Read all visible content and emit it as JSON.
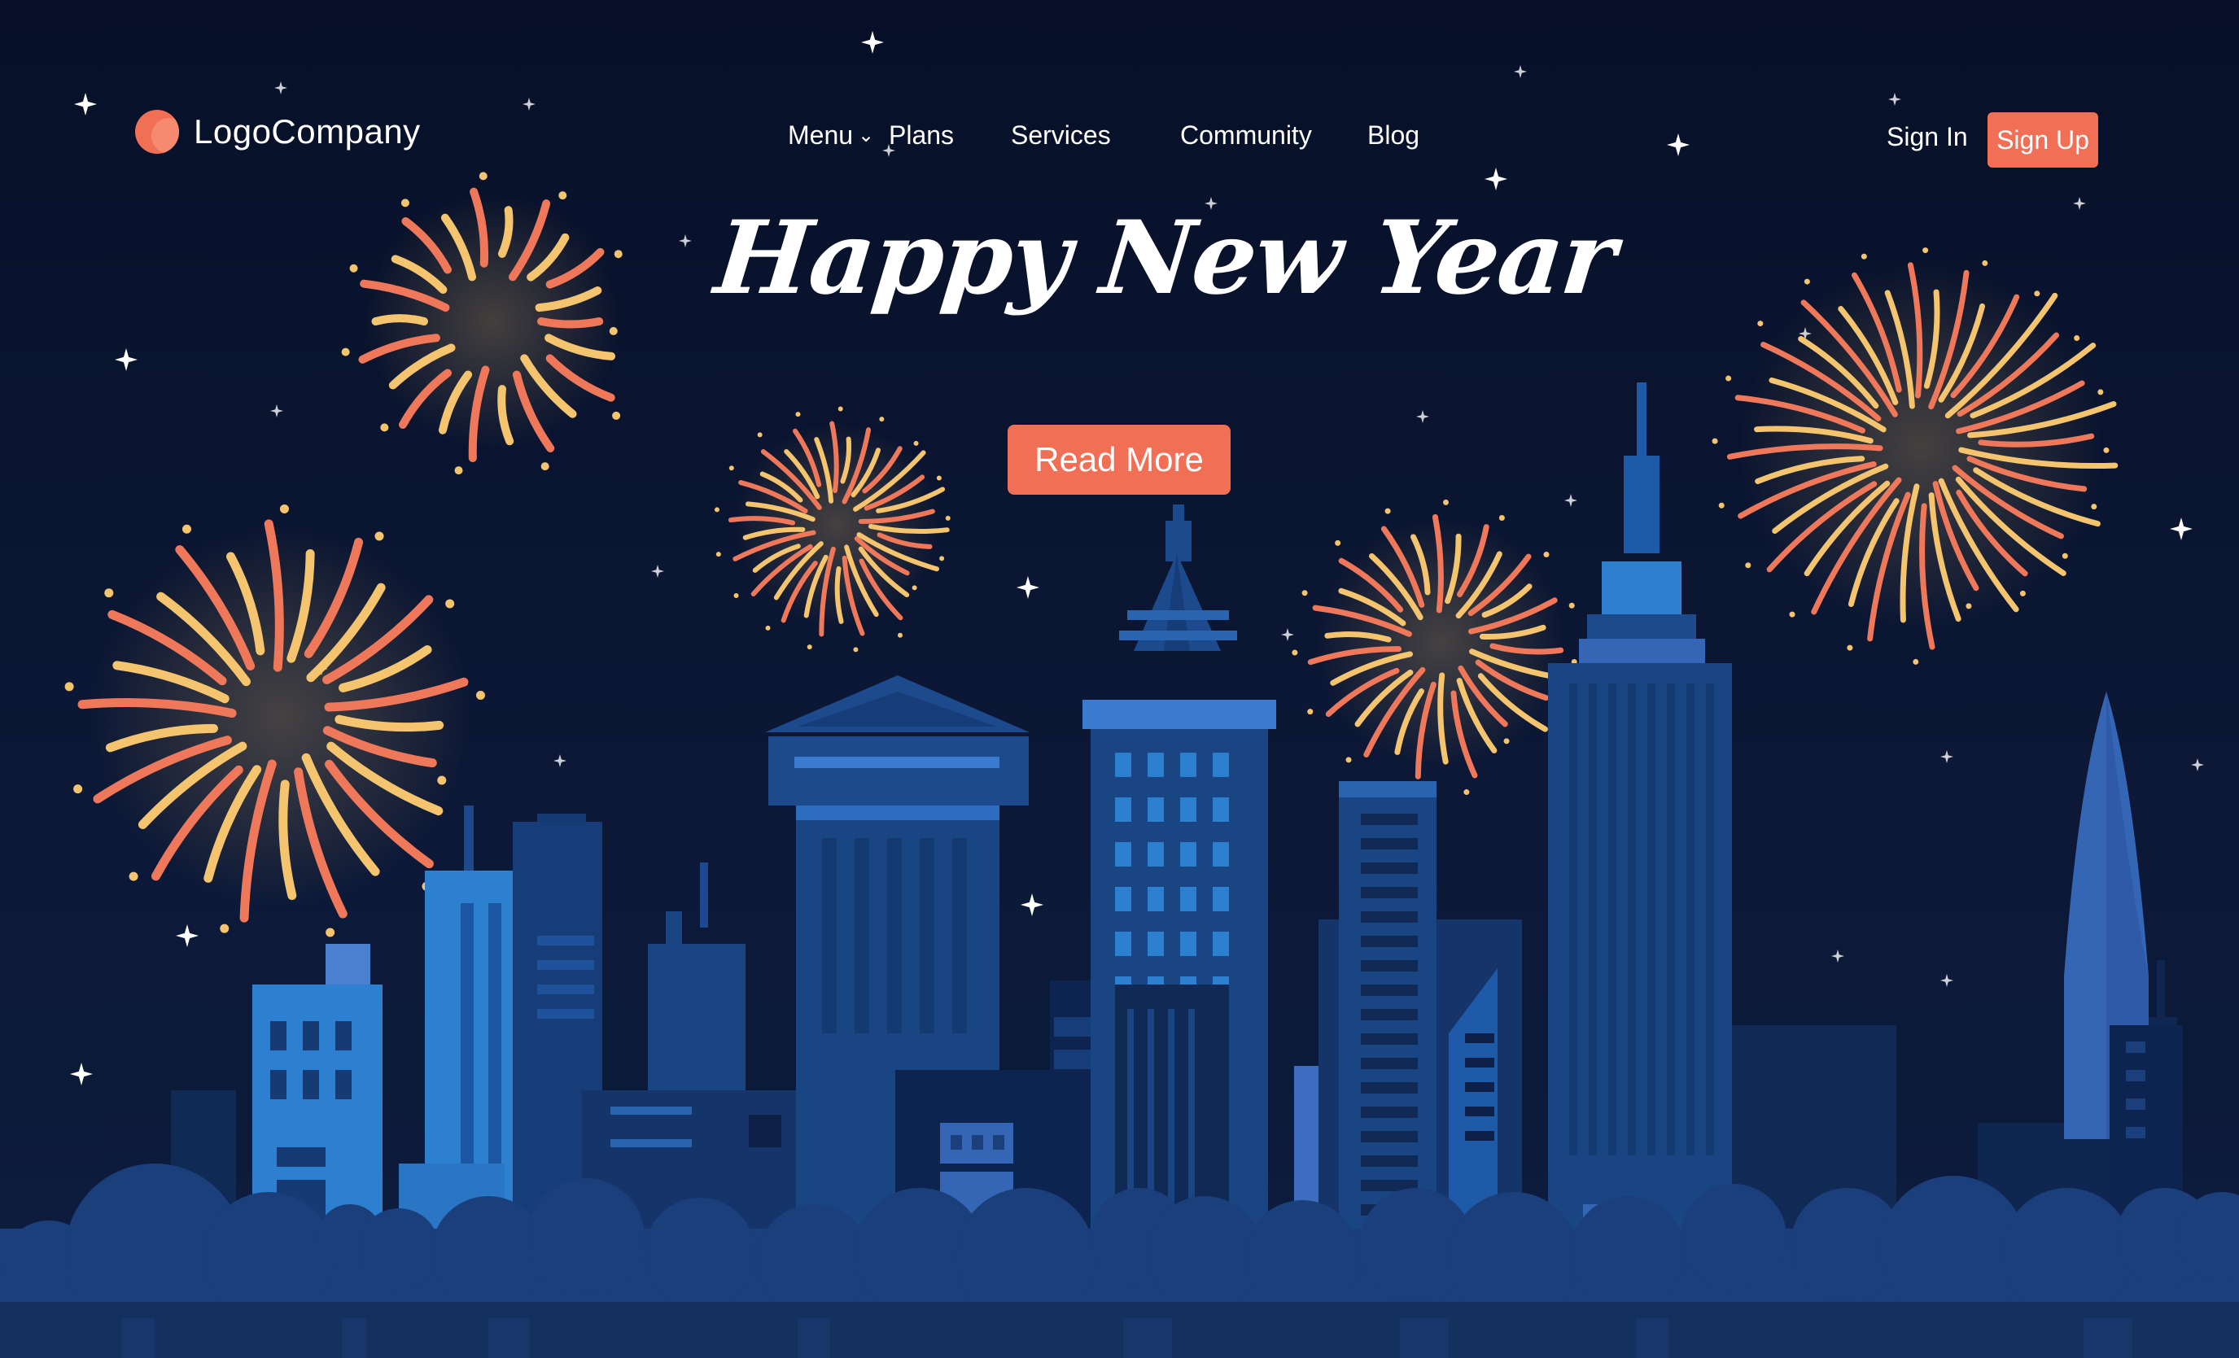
{
  "brand": {
    "name": "LogoCompany",
    "color": "#f06f55"
  },
  "nav": {
    "items": [
      {
        "label": "Menu",
        "has_dropdown": true,
        "icon": "chevron-down-icon"
      },
      {
        "label": "Plans"
      },
      {
        "label": "Services"
      },
      {
        "label": "Community"
      },
      {
        "label": "Blog"
      }
    ],
    "sign_in": "Sign In",
    "sign_up": "Sign Up"
  },
  "hero": {
    "headline": "Happy New Year",
    "cta_label": "Read More"
  },
  "colors": {
    "background": "#0b1330",
    "accent": "#f06f55",
    "firework_orange": "#f0785a",
    "firework_yellow": "#f5c46e",
    "building_dark": "#102a55",
    "building_mid": "#1c4a8c",
    "building_light": "#2d7fd0",
    "bushes": "#1a3f7a",
    "water": "#14305e"
  }
}
